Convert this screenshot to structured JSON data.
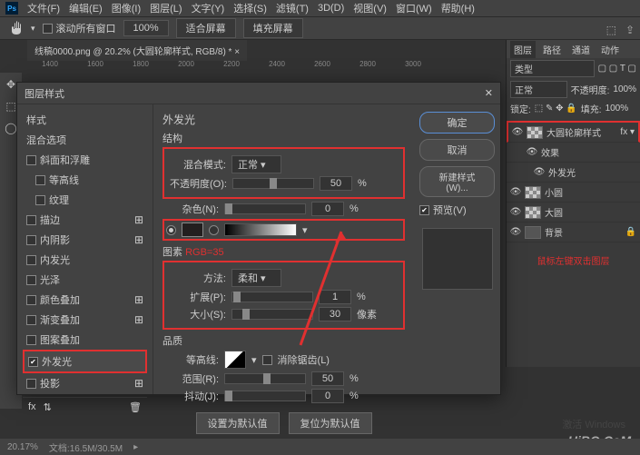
{
  "menu": {
    "file": "文件(F)",
    "edit": "编辑(E)",
    "image": "图像(I)",
    "layer": "图层(L)",
    "type": "文字(Y)",
    "select": "选择(S)",
    "filter": "滤镜(T)",
    "threeD": "3D(D)",
    "view": "视图(V)",
    "window": "窗口(W)",
    "help": "帮助(H)"
  },
  "options": {
    "scroll_all": "滚动所有窗口",
    "zoom": "100%",
    "fit": "适合屏幕",
    "fill": "填充屏幕"
  },
  "tab": {
    "title": "线稿0000.png @ 20.2% (大圆轮廓样式, RGB/8) *"
  },
  "ruler_marks": [
    "1400",
    "1600",
    "1800",
    "2000",
    "2200",
    "2400",
    "2600",
    "2800",
    "3000"
  ],
  "dialog": {
    "title": "图层样式",
    "styles_header": "样式",
    "blend_opts": "混合选项",
    "items": {
      "bevel": "斜面和浮雕",
      "contour_sub": "等高线",
      "texture": "纹理",
      "stroke": "描边",
      "inner_shadow": "内阴影",
      "inner_glow": "内发光",
      "satin": "光泽",
      "color_overlay": "颜色叠加",
      "gradient_overlay": "渐变叠加",
      "pattern_overlay": "图案叠加",
      "outer_glow": "外发光",
      "drop_shadow": "投影"
    },
    "outer_glow": {
      "title": "外发光",
      "structure": "结构",
      "blend_mode_lbl": "混合模式:",
      "blend_mode_val": "正常",
      "opacity_lbl": "不透明度(O):",
      "opacity_val": "50",
      "opacity_unit": "%",
      "noise_lbl": "杂色(N):",
      "noise_val": "0",
      "noise_unit": "%",
      "rgb_note": "RGB=35",
      "elements": "图素",
      "technique_lbl": "方法:",
      "technique_val": "柔和",
      "spread_lbl": "扩展(P):",
      "spread_val": "1",
      "spread_unit": "%",
      "size_lbl": "大小(S):",
      "size_val": "30",
      "size_unit": "像素",
      "quality": "品质",
      "contour_lbl": "等高线:",
      "antialias": "消除锯齿(L)",
      "range_lbl": "范围(R):",
      "range_val": "50",
      "range_unit": "%",
      "jitter_lbl": "抖动(J):",
      "jitter_val": "0",
      "jitter_unit": "%",
      "make_default": "设置为默认值",
      "reset_default": "复位为默认值"
    },
    "buttons": {
      "ok": "确定",
      "cancel": "取消",
      "new_style": "新建样式(W)...",
      "preview": "预览(V)"
    }
  },
  "layers": {
    "tabs": {
      "layer": "图层",
      "channel": "路径",
      "path": "通道",
      "action": "动作"
    },
    "kind": "类型",
    "mode": "正常",
    "opacity_lbl": "不透明度:",
    "opacity": "100%",
    "lock": "锁定:",
    "fill_lbl": "填充:",
    "fill": "100%",
    "items": {
      "main": "大圆轮廓样式",
      "fx": "效果",
      "outer_glow": "外发光",
      "small": "小圆",
      "big": "大圆",
      "bg": "背景"
    },
    "note": "鼠标左键双击图层"
  },
  "status": {
    "zoom": "20.17%",
    "doc": "文档:16.5M/30.5M"
  },
  "watermark": {
    "win": "激活 Windows",
    "brand": "UiBQ.CoM"
  }
}
